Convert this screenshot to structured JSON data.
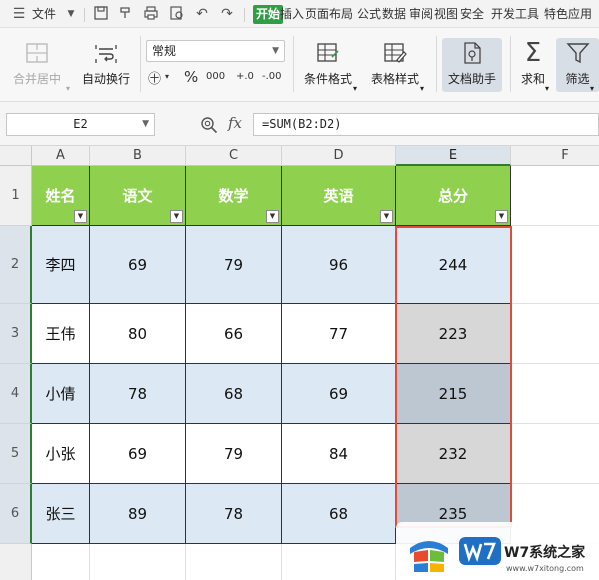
{
  "menu": {
    "file_label": "文件",
    "tabs": [
      "开始",
      "插入",
      "页面布局",
      "公式",
      "数据",
      "审阅",
      "视图",
      "安全",
      "开发工具",
      "特色应用"
    ]
  },
  "ribbon": {
    "merge_label": "合并居中",
    "wrap_label": "自动换行",
    "number_format": "常规",
    "percent_symbol": "%",
    "comma_symbol": "000",
    "inc_decimal": "+.0",
    "dec_decimal": "-.00",
    "cond_format_label": "条件格式",
    "table_style_label": "表格样式",
    "doc_helper_label": "文档助手",
    "sum_label": "求和",
    "filter_label": "筛选"
  },
  "formula_bar": {
    "cell_ref": "E2",
    "fx": "fx",
    "formula": "=SUM(B2:D2)"
  },
  "grid": {
    "columns": [
      "A",
      "B",
      "C",
      "D",
      "E",
      "F"
    ],
    "rows": [
      "1",
      "2",
      "3",
      "4",
      "5",
      "6"
    ],
    "headers": [
      "姓名",
      "语文",
      "数学",
      "英语",
      "总分"
    ],
    "data": [
      [
        "李四",
        "69",
        "79",
        "96",
        "244"
      ],
      [
        "王伟",
        "80",
        "66",
        "77",
        "223"
      ],
      [
        "小倩",
        "78",
        "68",
        "69",
        "215"
      ],
      [
        "小张",
        "69",
        "79",
        "84",
        "232"
      ],
      [
        "张三",
        "89",
        "78",
        "68",
        "235"
      ]
    ]
  },
  "colors": {
    "header_fill": "#8fd14f",
    "band_fill": "#dce8f3",
    "plain_fill": "#ffffff",
    "selection_fill": "#bcc7d2",
    "selection_alt_fill": "#d7d7d7",
    "selection_border": "#e04b3a",
    "active_tab": "#2f9e44"
  },
  "watermark": {
    "text": "W7系统之家",
    "sub": "www.w7xitong.com"
  }
}
